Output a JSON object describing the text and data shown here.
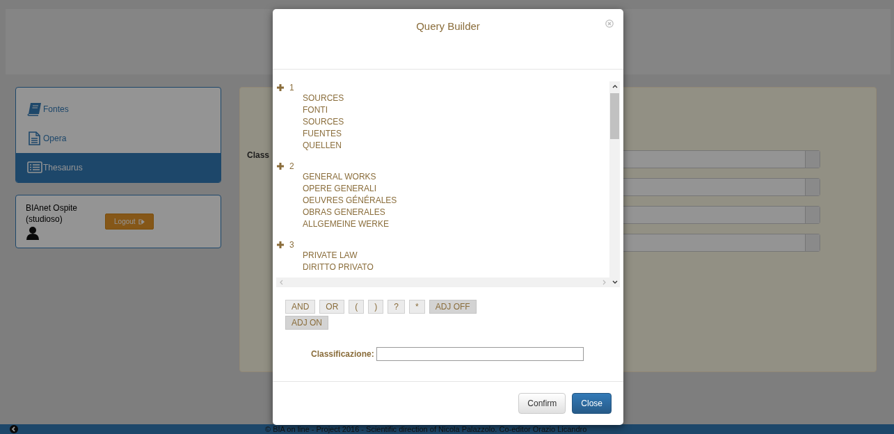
{
  "sidebar": {
    "items": [
      {
        "label": "Fontes",
        "kind": "book",
        "selected": false
      },
      {
        "label": "Opera",
        "kind": "document",
        "selected": false
      },
      {
        "label": "Thesaurus",
        "kind": "list",
        "selected": true
      }
    ]
  },
  "user": {
    "name": "BIAnet Ospite",
    "role": "(studioso)",
    "logout": "Logout"
  },
  "search_panel": {
    "label": "Class"
  },
  "footer": {
    "text": "© BIA on line - Project 2016 - Scientific direction of Nicola Palazzolo. Co-editor Orazio Licandro"
  },
  "modal": {
    "title": "Query Builder",
    "tree": [
      {
        "label": "1",
        "expanded": false,
        "terms": [
          "SOURCES",
          "FONTI",
          "SOURCES",
          "FUENTES",
          "QUELLEN"
        ]
      },
      {
        "label": "2",
        "expanded": false,
        "terms": [
          "GENERAL WORKS",
          "OPERE GENERALI",
          "OEUVRES GÉNÉRALES",
          "OBRAS GENERALES",
          "ALLGEMEINE WERKE"
        ]
      },
      {
        "label": "3",
        "expanded": false,
        "terms": [
          "PRIVATE LAW",
          "DIRITTO PRIVATO"
        ]
      }
    ],
    "operators": [
      {
        "label": "AND",
        "kind": "operator"
      },
      {
        "label": "OR",
        "kind": "operator"
      },
      {
        "label": "(",
        "kind": "operator"
      },
      {
        "label": ")",
        "kind": "operator"
      },
      {
        "label": "?",
        "kind": "operator"
      },
      {
        "label": "*",
        "kind": "operator"
      },
      {
        "label": "ADJ OFF",
        "kind": "toggle"
      },
      {
        "label": "ADJ ON",
        "kind": "toggle"
      }
    ],
    "field": {
      "label": "Classificazione:"
    },
    "buttons": [
      {
        "label": "Confirm",
        "kind": "default"
      },
      {
        "label": "Close",
        "kind": "primary"
      }
    ]
  }
}
